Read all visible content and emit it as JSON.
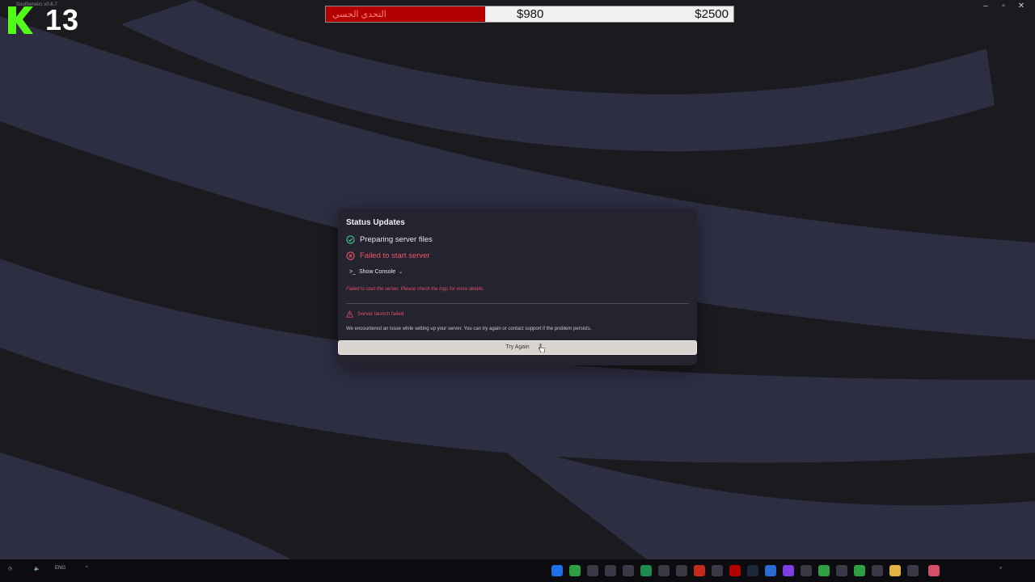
{
  "window": {
    "title": "SoulServers v0.6.7"
  },
  "overlay": {
    "counter": "13"
  },
  "donation_bar": {
    "label": "التحدي الحسي",
    "current": "$980",
    "goal": "$2500",
    "progress": 0.39,
    "fill_color": "#b30000"
  },
  "status": {
    "title": "Status Updates",
    "steps": [
      {
        "label": "Preparing server files",
        "state": "success",
        "icon": "check-circle-icon"
      },
      {
        "label": "Failed to start server",
        "state": "error",
        "icon": "x-circle-icon"
      }
    ],
    "show_console_label": "Show Console",
    "error_message": "Failed to start the server. Please check the logs for more details.",
    "alert_title": "Server launch failed",
    "alert_description": "We encountered an issue while setting up your server. You can try again or contact support if the problem persists.",
    "retry_label": "Try Again"
  },
  "taskbar": {
    "language": "ENG"
  },
  "colors": {
    "accent_error": "#f0566a",
    "success": "#3ecf8e",
    "panel_bg": "#24232f"
  }
}
